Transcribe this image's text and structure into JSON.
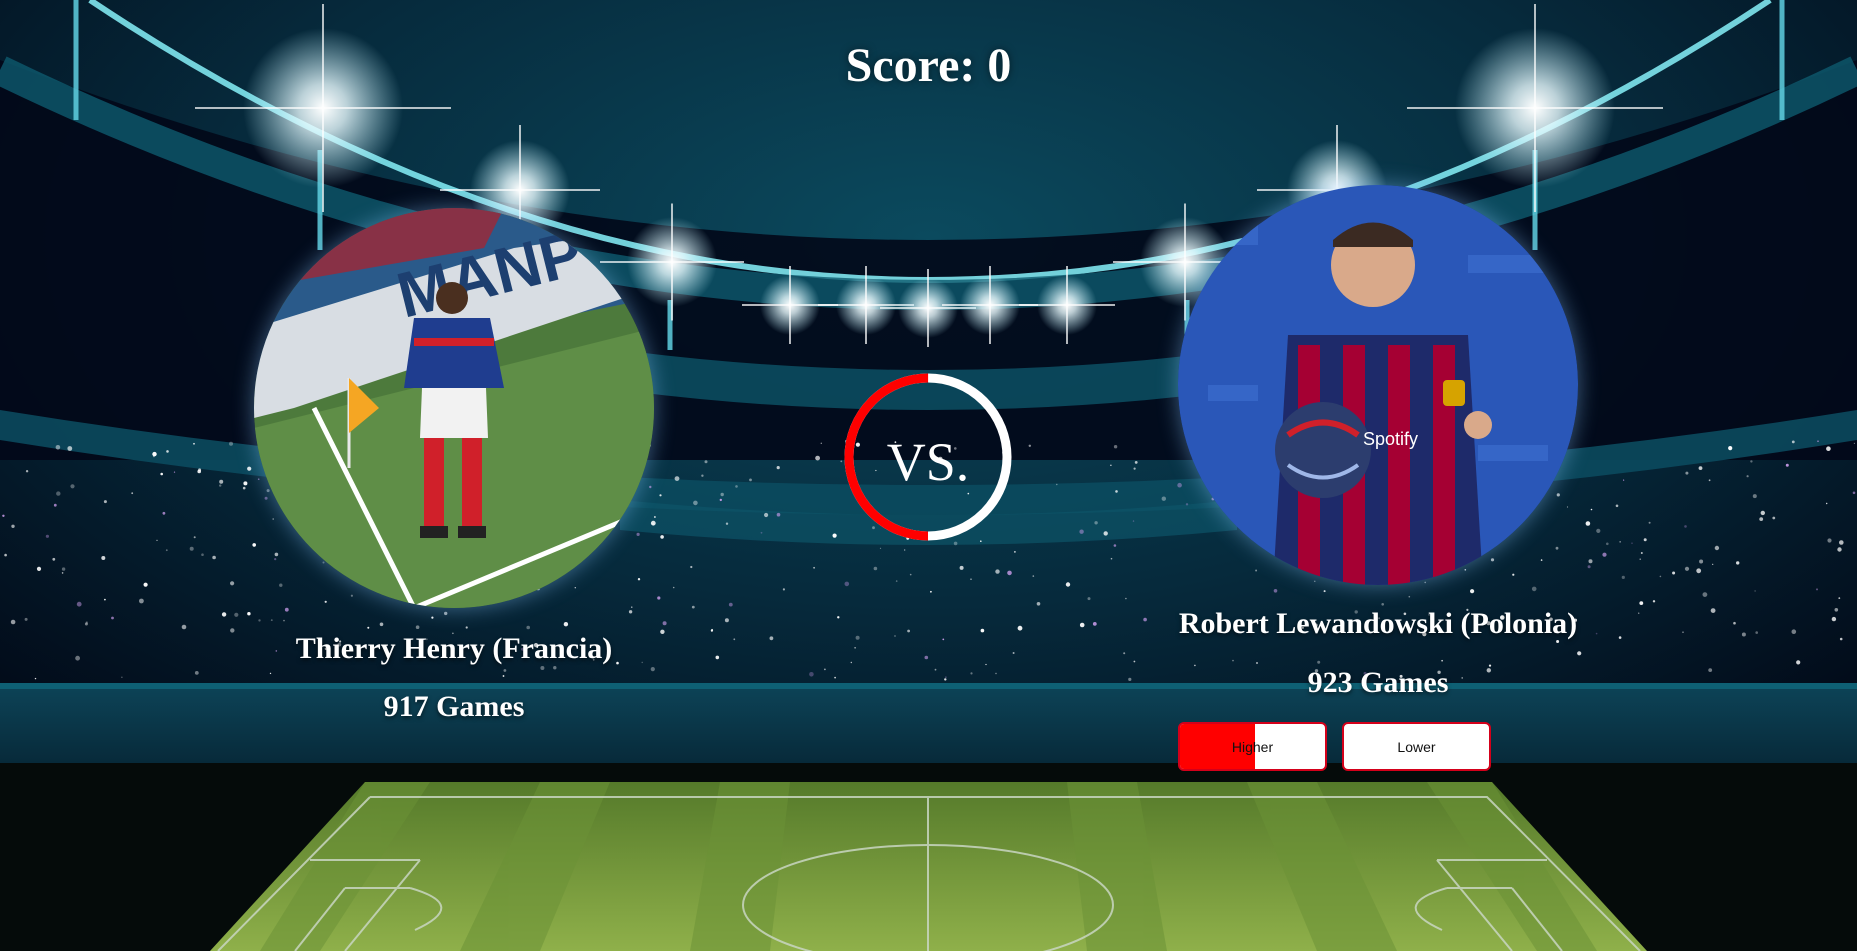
{
  "score_text": "Score: 0",
  "vs_label": "VS.",
  "timer_progress": 0.5,
  "colors": {
    "accent_red": "#ff0000",
    "button_border": "#d4001a",
    "night_sky": "#020b1a",
    "light_cyan": "#7fe6ee"
  },
  "left_player": {
    "name": "Thierry Henry (Francia)",
    "games": "917 Games",
    "photo_icon": "player-photo-france"
  },
  "right_player": {
    "name": "Robert Lewandowski (Polonia)",
    "games": "923 Games",
    "photo_icon": "player-photo-barcelona"
  },
  "buttons": {
    "higher_label": "Higher",
    "lower_label": "Lower",
    "higher_hover_progress": 0.52
  }
}
